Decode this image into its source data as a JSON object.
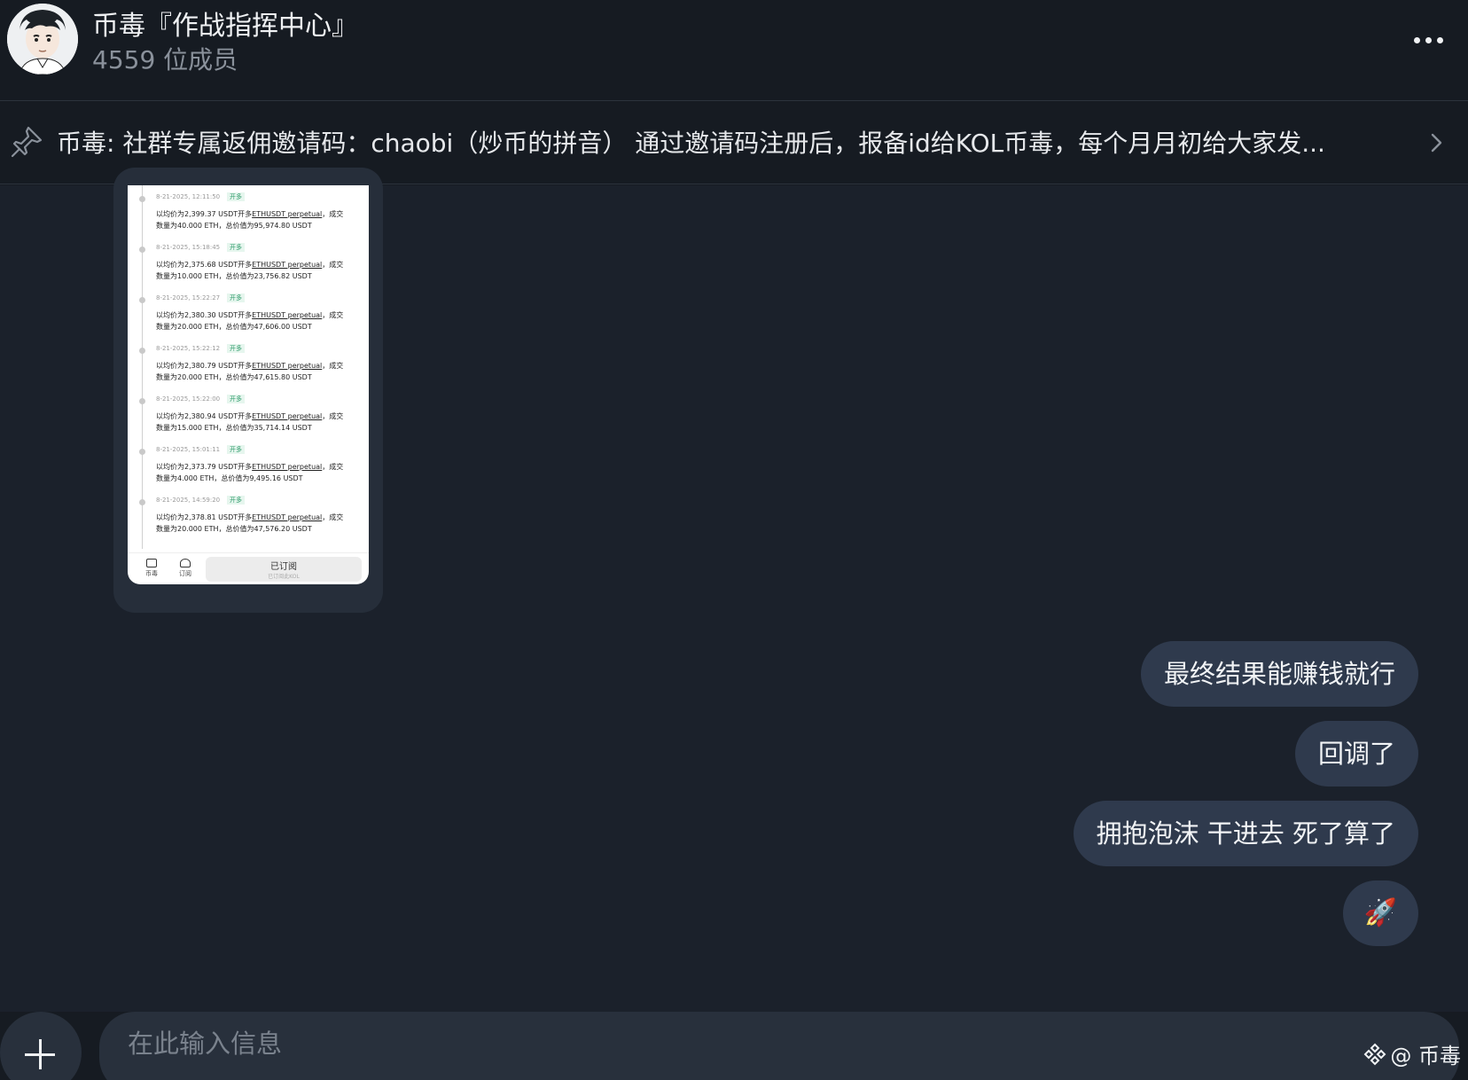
{
  "header": {
    "title": "币毒『作战指挥中心』",
    "members": "4559 位成员",
    "more_icon": "more-horizontal-icon"
  },
  "pinned": {
    "icon": "pin-icon",
    "text": "币毒: 社群专属返佣邀请码：chaobi（炒币的拼音） 通过邀请码注册后，报备id给KOL币毒，每个月月初给大家发...",
    "chevron_icon": "chevron-right-icon"
  },
  "image_message": {
    "entries": [
      {
        "date": "8-21-2025, 12:11:50",
        "tag": "开多",
        "line1_pre": "以均价为2,399.37 USDT开多",
        "symbol": "ETHUSDT perpetual",
        "line1_post": "，成交",
        "line2": "数量为40.000 ETH，总价值为95,974.80 USDT"
      },
      {
        "date": "8-21-2025, 15:18:45",
        "tag": "开多",
        "line1_pre": "以均价为2,375.68 USDT开多",
        "symbol": "ETHUSDT perpetual",
        "line1_post": "，成交",
        "line2": "数量为10.000 ETH，总价值为23,756.82 USDT"
      },
      {
        "date": "8-21-2025, 15:22:27",
        "tag": "开多",
        "line1_pre": "以均价为2,380.30 USDT开多",
        "symbol": "ETHUSDT perpetual",
        "line1_post": "，成交",
        "line2": "数量为20.000 ETH，总价值为47,606.00 USDT"
      },
      {
        "date": "8-21-2025, 15:22:12",
        "tag": "开多",
        "line1_pre": "以均价为2,380.79 USDT开多",
        "symbol": "ETHUSDT perpetual",
        "line1_post": "，成交",
        "line2": "数量为20.000 ETH，总价值为47,615.80 USDT"
      },
      {
        "date": "8-21-2025, 15:22:00",
        "tag": "开多",
        "line1_pre": "以均价为2,380.94 USDT开多",
        "symbol": "ETHUSDT perpetual",
        "line1_post": "，成交",
        "line2": "数量为15.000 ETH，总价值为35,714.14 USDT"
      },
      {
        "date": "8-21-2025, 15:01:11",
        "tag": "开多",
        "line1_pre": "以均价为2,373.79 USDT开多",
        "symbol": "ETHUSDT perpetual",
        "line1_post": "，成交",
        "line2": "数量为4.000 ETH，总价值为9,495.16 USDT"
      },
      {
        "date": "8-21-2025, 14:59:20",
        "tag": "开多",
        "line1_pre": "以均价为2,378.81 USDT开多",
        "symbol": "ETHUSDT perpetual",
        "line1_post": "，成交",
        "line2": "数量为20.000 ETH，总价值为47,576.20 USDT"
      }
    ],
    "bottom": {
      "icon1_label": "币毒",
      "icon2_label": "订阅",
      "subscribed_label": "已订阅",
      "subscribed_sub": "已订阅此KOL"
    }
  },
  "messages": [
    {
      "text": "最终结果能赚钱就行"
    },
    {
      "text": "回调了"
    },
    {
      "text": "拥抱泡沫 干进去 死了算了"
    },
    {
      "text": "🚀"
    }
  ],
  "composer": {
    "add_icon": "plus-icon",
    "placeholder": "在此输入信息",
    "watermark": "@ 币毒",
    "watermark_icon": "binance-logo-icon"
  }
}
